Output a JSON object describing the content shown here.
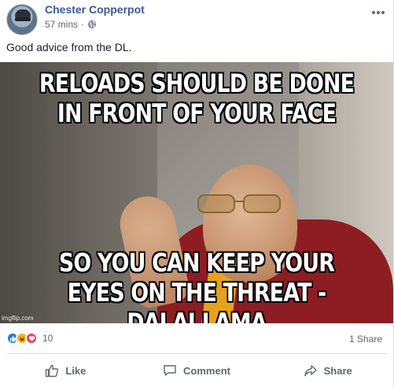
{
  "post": {
    "author": "Chester Copperpot",
    "time": "57 mins",
    "separator": "·",
    "privacy_icon": "globe-icon",
    "text": "Good advice from the DL."
  },
  "image": {
    "caption_top": "RELOADS SHOULD BE DONE IN FRONT OF YOUR FACE",
    "caption_bottom": "SO YOU CAN KEEP YOUR EYES ON THE THREAT - DALAI LAMA",
    "watermark": "imgflip.com"
  },
  "stats": {
    "reaction_icons": [
      "like-icon",
      "haha-icon",
      "love-icon"
    ],
    "reaction_count": "10",
    "shares": "1 Share"
  },
  "actions": {
    "like": "Like",
    "comment": "Comment",
    "share": "Share"
  },
  "colors": {
    "author_link": "#385898",
    "like_blue": "#1877f2",
    "haha_yellow": "#f7b125",
    "love_red": "#f33e58",
    "muted_text": "#606770"
  }
}
